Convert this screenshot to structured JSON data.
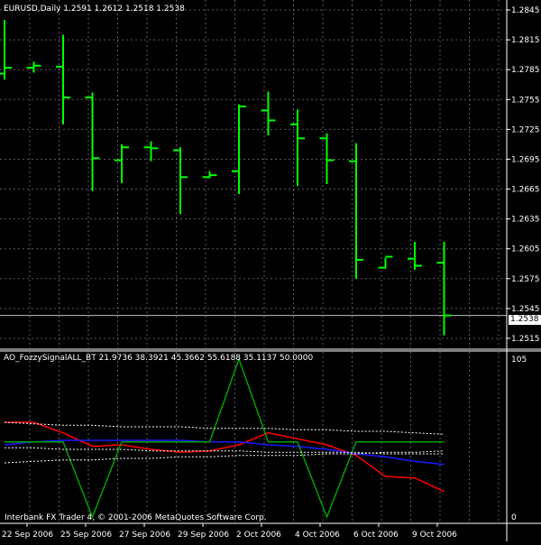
{
  "chart_data": [
    {
      "type": "ohlc",
      "title": "EURUSD,Daily  1.2591 1.2612 1.2518 1.2538",
      "bar_color": "#00ff00",
      "ylim": [
        1.2505,
        1.2855
      ],
      "y_ticks": [
        "1.2845",
        "1.2815",
        "1.2785",
        "1.2755",
        "1.2725",
        "1.2695",
        "1.2665",
        "1.2635",
        "1.2605",
        "1.2575",
        "1.2545",
        "1.2515"
      ],
      "current_price": "1.2538",
      "bars": [
        {
          "o": 1.2781,
          "h": 1.2835,
          "l": 1.2775,
          "c": 1.2787
        },
        {
          "o": 1.2787,
          "h": 1.2793,
          "l": 1.2782,
          "c": 1.2789
        },
        {
          "o": 1.2788,
          "h": 1.282,
          "l": 1.273,
          "c": 1.2757
        },
        {
          "o": 1.2757,
          "h": 1.2762,
          "l": 1.2663,
          "c": 1.2696
        },
        {
          "o": 1.2694,
          "h": 1.271,
          "l": 1.2671,
          "c": 1.2707
        },
        {
          "o": 1.2707,
          "h": 1.2713,
          "l": 1.2693,
          "c": 1.2706
        },
        {
          "o": 1.2704,
          "h": 1.2707,
          "l": 1.264,
          "c": 1.2677
        },
        {
          "o": 1.2677,
          "h": 1.2683,
          "l": 1.2676,
          "c": 1.2679
        },
        {
          "o": 1.2683,
          "h": 1.275,
          "l": 1.266,
          "c": 1.2748
        },
        {
          "o": 1.2744,
          "h": 1.2763,
          "l": 1.2719,
          "c": 1.2734
        },
        {
          "o": 1.273,
          "h": 1.2745,
          "l": 1.2668,
          "c": 1.2716
        },
        {
          "o": 1.2716,
          "h": 1.2721,
          "l": 1.267,
          "c": 1.2694
        },
        {
          "o": 1.2693,
          "h": 1.2711,
          "l": 1.2575,
          "c": 1.2594
        },
        {
          "o": 1.2586,
          "h": 1.2596,
          "l": 1.2585,
          "c": 1.2597
        },
        {
          "o": 1.2595,
          "h": 1.2612,
          "l": 1.2584,
          "c": 1.2588
        },
        {
          "o": 1.2591,
          "h": 1.2612,
          "l": 1.2518,
          "c": 1.2538
        }
      ]
    },
    {
      "type": "line",
      "title": "AO_FozzySignalALL_BT 21.9736 38.3921 45.3662 55.6188 35.1137 50.0000",
      "ylim": [
        0,
        105
      ],
      "y_ticks": [
        "105",
        "0"
      ],
      "series": [
        {
          "color": "#ff0000",
          "style": "solid",
          "values": [
            63,
            63,
            56,
            47,
            48,
            45,
            43,
            44,
            48,
            56,
            52,
            48,
            41,
            27,
            26,
            17
          ]
        },
        {
          "color": "#1a1aff",
          "style": "solid",
          "values": [
            48,
            50,
            51,
            51,
            51,
            51,
            51,
            50,
            50,
            48,
            47,
            45,
            42,
            40,
            37,
            35
          ]
        },
        {
          "color": "#00a000",
          "style": "solid",
          "values": [
            50,
            50,
            50,
            0,
            50,
            50,
            50,
            50,
            105,
            50,
            50,
            0,
            50,
            50,
            50,
            50
          ]
        },
        {
          "color": "#ffffff",
          "style": "dotted",
          "values": [
            63,
            62,
            61,
            61,
            60,
            60,
            60,
            59,
            59,
            59,
            58,
            58,
            57,
            57,
            56,
            55
          ]
        },
        {
          "color": "#ffffff",
          "style": "dotted",
          "values": [
            36,
            37,
            38,
            38,
            39,
            39,
            40,
            40,
            41,
            41,
            41,
            42,
            42,
            43,
            43,
            44
          ]
        },
        {
          "color": "#ffffff",
          "style": "dotted",
          "values": [
            46,
            46,
            45,
            45,
            45,
            44,
            44,
            44,
            44,
            43,
            43,
            43,
            43,
            42,
            42,
            42
          ]
        }
      ]
    }
  ],
  "x_labels": [
    "22 Sep 2006",
    "25 Sep 2006",
    "27 Sep 2006",
    "29 Sep 2006",
    "2 Oct 2006",
    "4 Oct 2006",
    "6 Oct 2006",
    "9 Oct 2006"
  ],
  "watermark": "Interbank FX Trader 4, © 2001-2006 MetaQuotes Software Corp."
}
